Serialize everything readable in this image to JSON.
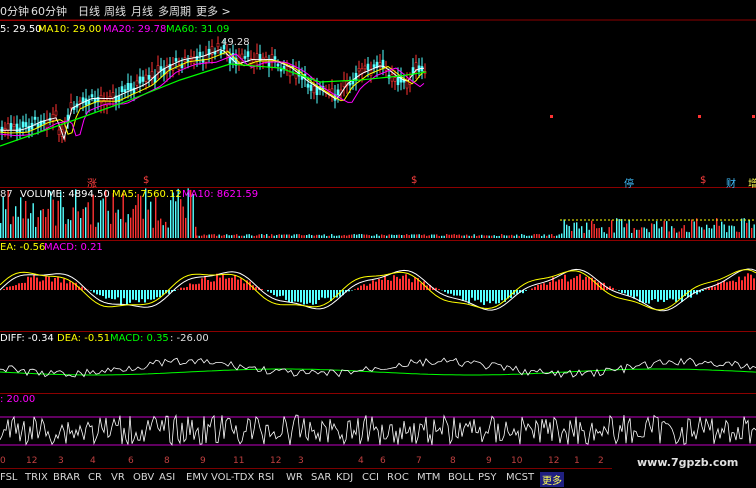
{
  "toolbar": {
    "items": [
      "0分钟",
      "60分钟",
      "日线",
      "周线",
      "月线",
      "多周期",
      "更多 >"
    ]
  },
  "price_panel": {
    "ma5": "5: 29.50",
    "ma10": "MA10: 29.00",
    "ma20": "MA20: 29.78",
    "ma60": "MA60: 31.09",
    "high_marker": "49.28",
    "flags": [
      "涨",
      "$",
      "$",
      "停",
      "$",
      "财",
      "增"
    ]
  },
  "volume_panel": {
    "prefix": "87",
    "volume": "VOLUME: 4894.50",
    "ma5": "MA5: 7560.12",
    "ma10": "MA10: 8621.59"
  },
  "macd_panel": {
    "dea": "EA: -0.56",
    "macd": "MACD: 0.21"
  },
  "dmi_panel": {
    "diff": "DIFF: -0.34",
    "dea": "DEA: -0.51",
    "macd": "MACD: 0.35",
    "extra": ": -26.00"
  },
  "osc_panel": {
    "value": ": 20.00"
  },
  "axis_ticks": [
    "0",
    "12",
    "3",
    "4",
    "6",
    "8",
    "9",
    "11",
    "12",
    "3",
    "4",
    "6",
    "7",
    "8",
    "9",
    "10",
    "12",
    "1",
    "2"
  ],
  "bottom_tabs": [
    "FSL",
    "TRIX",
    "BRAR",
    "CR",
    "VR",
    "OBV",
    "ASI",
    "EMV",
    "VOL-TDX",
    "RSI",
    "WR",
    "SAR",
    "KDJ",
    "CCI",
    "ROC",
    "MTM",
    "BOLL",
    "PSY",
    "MCST",
    "更多"
  ],
  "watermark": "www.7gpzb.com",
  "colors": {
    "up": "#ff3232",
    "down": "#54ffff",
    "ma5": "#ffffff",
    "ma10": "#ffff00",
    "ma20": "#ff00ff",
    "ma60": "#00ff00",
    "grid": "#8b0000"
  }
}
